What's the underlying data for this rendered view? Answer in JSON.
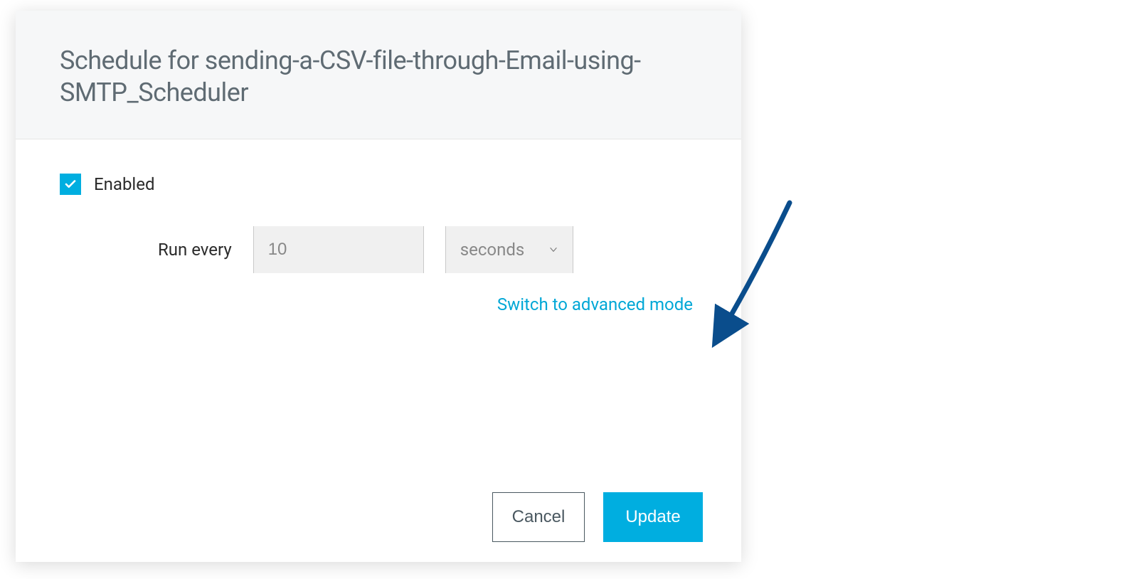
{
  "dialog": {
    "title": "Schedule for sending-a-CSV-file-through-Email-using-SMTP_Scheduler"
  },
  "form": {
    "enabled_label": "Enabled",
    "enabled_checked": true,
    "interval_label": "Run every",
    "interval_value": "10",
    "interval_unit": "seconds",
    "advanced_link": "Switch to advanced mode"
  },
  "buttons": {
    "cancel": "Cancel",
    "update": "Update"
  },
  "colors": {
    "accent": "#00aee0",
    "link": "#00a7d6",
    "arrow": "#0a4d8c"
  }
}
